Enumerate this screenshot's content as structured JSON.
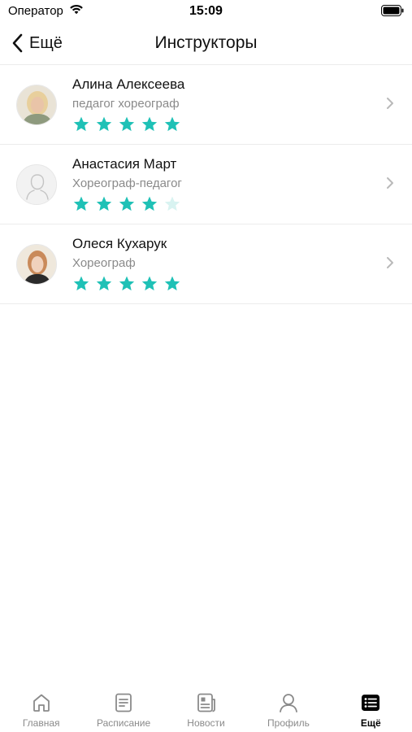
{
  "status_bar": {
    "carrier": "Оператор",
    "time": "15:09"
  },
  "nav": {
    "back_label": "Ещё",
    "title": "Инструкторы"
  },
  "colors": {
    "star_filled": "#1fc1b6",
    "star_empty": "#d8f3f1",
    "text_primary": "#111111",
    "text_secondary": "#8a8a8a"
  },
  "instructors": [
    {
      "name": "Алина Алексеева",
      "role": "педагог хореограф",
      "rating": 5,
      "avatar": "photo"
    },
    {
      "name": "Анастасия Март",
      "role": "Хореограф-педагог",
      "rating": 4,
      "avatar": "placeholder"
    },
    {
      "name": "Олеся Кухарук",
      "role": "Хореограф",
      "rating": 5,
      "avatar": "photo"
    }
  ],
  "tabs": [
    {
      "label": "Главная",
      "icon": "home-icon"
    },
    {
      "label": "Расписание",
      "icon": "schedule-icon"
    },
    {
      "label": "Новости",
      "icon": "news-icon"
    },
    {
      "label": "Профиль",
      "icon": "profile-icon"
    },
    {
      "label": "Ещё",
      "icon": "more-icon",
      "active": true
    }
  ]
}
